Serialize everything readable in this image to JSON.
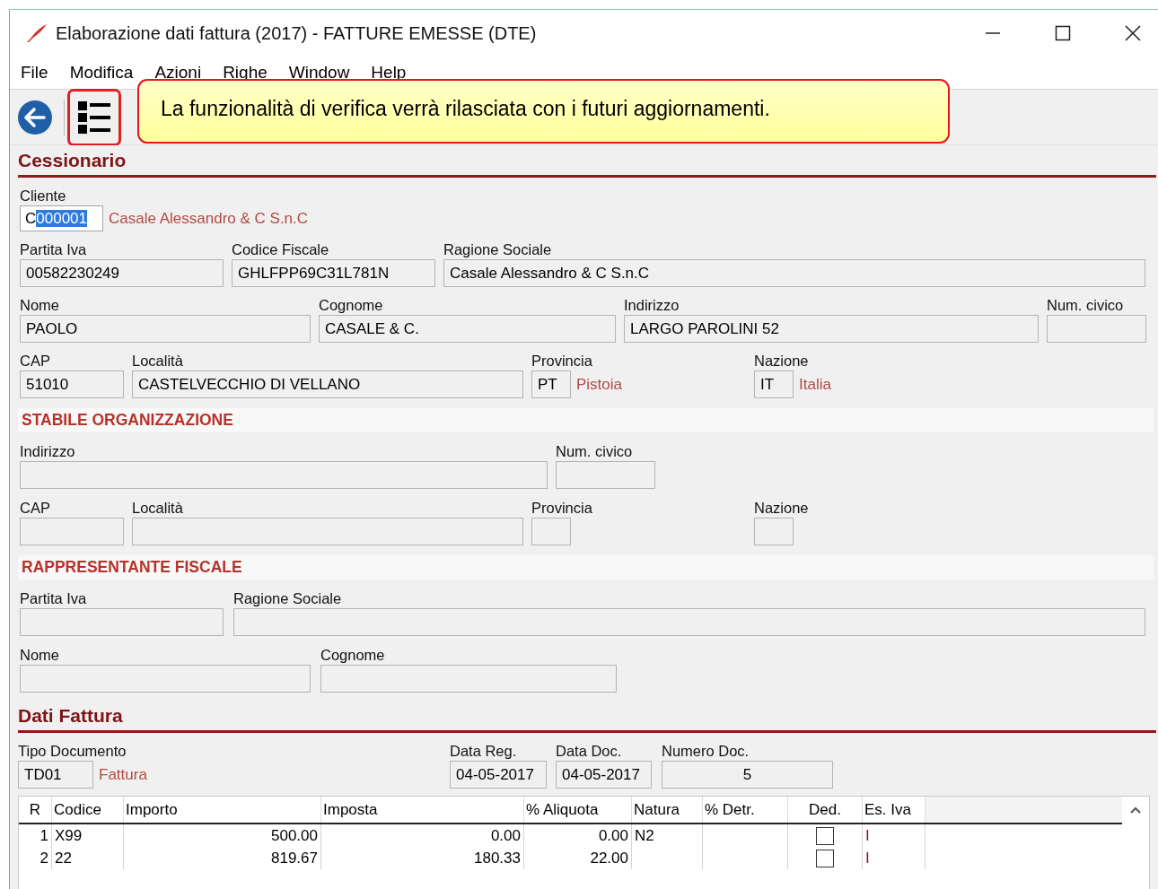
{
  "window": {
    "title": "Elaborazione dati fattura (2017) - FATTURE EMESSE (DTE)"
  },
  "menu": [
    {
      "label": "File"
    },
    {
      "label": "Modifica"
    },
    {
      "label": "Azioni"
    },
    {
      "label": "Righe"
    },
    {
      "label": "Window"
    },
    {
      "label": "Help"
    }
  ],
  "toolbar": [
    {
      "kind": "back",
      "highlighted": false
    },
    {
      "kind": "list",
      "highlighted": true
    }
  ],
  "callout": {
    "text": "La funzionalità di verifica verrà rilasciata con i futuri aggiornamenti."
  },
  "form": [
    {
      "kind": "heading",
      "title": "Cessionario"
    },
    {
      "kind": "fields",
      "fields": [
        {
          "label": "Cliente",
          "value_parts": [
            {
              "text": "C",
              "selected": false
            },
            {
              "text": "000001",
              "selected": true
            }
          ],
          "description": "Casale Alessandro & C S.n.C",
          "editable": true
        }
      ]
    },
    {
      "kind": "fields",
      "fields": [
        {
          "label": "Partita Iva",
          "value": "00582230249",
          "editable": false
        },
        {
          "label": "Codice Fiscale",
          "value": "GHLFPP69C31L781N",
          "editable": false
        },
        {
          "label": "Ragione Sociale",
          "value": "Casale Alessandro & C S.n.C",
          "editable": false
        }
      ]
    },
    {
      "kind": "fields",
      "fields": [
        {
          "label": "Nome",
          "value": "PAOLO",
          "editable": false
        },
        {
          "label": "Cognome",
          "value": "CASALE & C.",
          "editable": false
        },
        {
          "label": "Indirizzo",
          "value": "LARGO PAROLINI 52",
          "editable": false
        },
        {
          "label": "Num. civico",
          "editable": false
        }
      ]
    },
    {
      "kind": "fields",
      "fields": [
        {
          "label": "CAP",
          "value": "51010",
          "editable": false
        },
        {
          "label": "Località",
          "value": "CASTELVECCHIO DI VELLANO",
          "editable": false
        },
        {
          "label": "Provincia",
          "value": "PT",
          "description": "Pistoia",
          "editable": false
        },
        {
          "label": "Nazione",
          "value": "IT",
          "description": "Italia",
          "editable": false
        }
      ]
    },
    {
      "kind": "band",
      "title": "STABILE ORGANIZZAZIONE"
    },
    {
      "kind": "fields",
      "fields": [
        {
          "label": "Indirizzo",
          "editable": false
        },
        {
          "label": "Num. civico",
          "editable": false
        }
      ]
    },
    {
      "kind": "fields",
      "fields": [
        {
          "label": "CAP",
          "editable": false
        },
        {
          "label": "Località",
          "editable": false
        },
        {
          "label": "Provincia",
          "editable": false
        },
        {
          "label": "Nazione",
          "editable": false
        }
      ]
    },
    {
      "kind": "band",
      "title": "RAPPRESENTANTE FISCALE"
    },
    {
      "kind": "fields",
      "fields": [
        {
          "label": "Partita Iva",
          "editable": false
        },
        {
          "label": "Ragione Sociale",
          "editable": false
        }
      ]
    },
    {
      "kind": "fields",
      "fields": [
        {
          "label": "Nome",
          "editable": false
        },
        {
          "label": "Cognome",
          "editable": false
        }
      ]
    },
    {
      "kind": "heading",
      "title": "Dati Fattura"
    },
    {
      "kind": "fields",
      "fields": [
        {
          "label": "Tipo Documento",
          "value": "TD01",
          "description": "Fattura",
          "editable": false
        },
        {
          "label": "Data Reg.",
          "value": "04-05-2017",
          "editable": false
        },
        {
          "label": "Data Doc.",
          "value": "04-05-2017",
          "editable": false
        },
        {
          "label": "Numero Doc.",
          "value": "5",
          "editable": false,
          "kind": "number"
        }
      ]
    }
  ],
  "table": {
    "columns": [
      {
        "label": "R",
        "kind": "text"
      },
      {
        "label": "Codice",
        "kind": "text"
      },
      {
        "label": "Importo",
        "kind": "text"
      },
      {
        "label": "Imposta",
        "kind": "text"
      },
      {
        "label": "% Aliquota",
        "kind": "text"
      },
      {
        "label": "Natura",
        "kind": "text"
      },
      {
        "label": "% Detr.",
        "kind": "text"
      },
      {
        "label": "Ded.",
        "kind": "check"
      },
      {
        "label": "Es. Iva",
        "kind": "text"
      }
    ],
    "rows": [
      {
        "cells": [
          "1",
          "X99",
          "500.00",
          "0.00",
          "0.00",
          "N2",
          null,
          false,
          "I"
        ]
      },
      {
        "cells": [
          "2",
          "22",
          "819.67",
          "180.33",
          "22.00",
          null,
          null,
          false,
          "I"
        ]
      }
    ]
  }
}
